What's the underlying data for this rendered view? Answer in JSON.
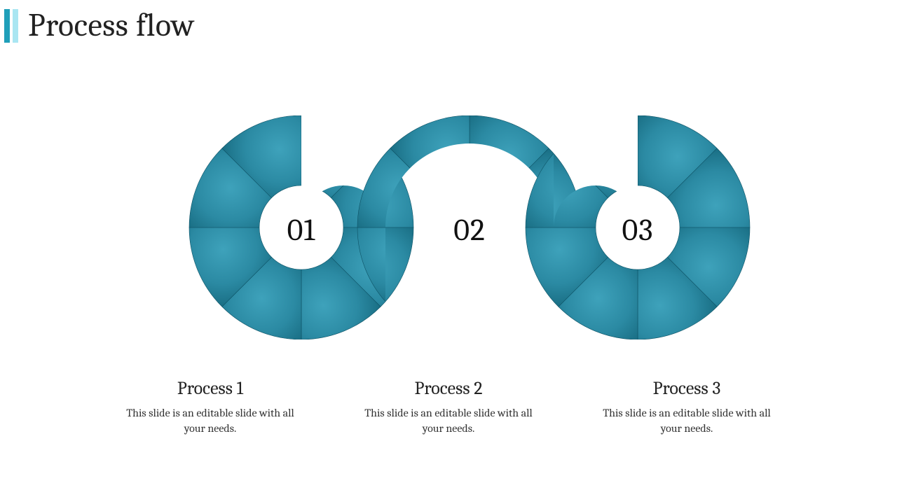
{
  "title": "Process flow",
  "steps": [
    {
      "number": "01",
      "title": "Process 1",
      "desc": "This slide is an editable slide with all your needs."
    },
    {
      "number": "02",
      "title": "Process 2",
      "desc": "This slide is an editable slide with all your needs."
    },
    {
      "number": "03",
      "title": "Process 3",
      "desc": "This slide is an editable slide with all your needs."
    }
  ],
  "colors": {
    "accent_dark": "#1a6f85",
    "accent_mid": "#2b8aa3",
    "accent_light": "#3ea2bb"
  }
}
